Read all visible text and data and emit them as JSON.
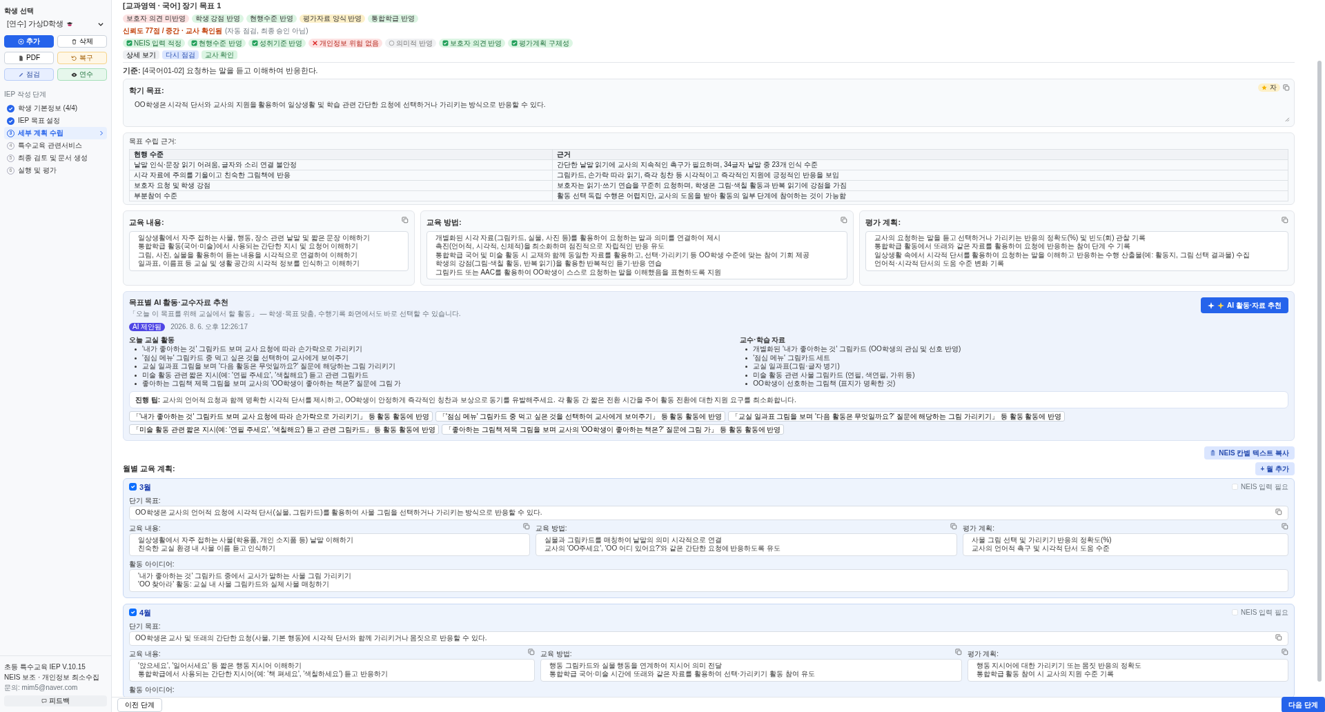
{
  "sidebar": {
    "student_label": "학생 선택",
    "student_select": "[연수] 가상D학생",
    "buttons": [
      {
        "label": "추가",
        "kind": "primary"
      },
      {
        "label": "삭제",
        "kind": "outline"
      },
      {
        "label": "PDF",
        "kind": "outline"
      },
      {
        "label": "복구",
        "kind": "warning"
      },
      {
        "label": "점검",
        "kind": "info"
      },
      {
        "label": "연수",
        "kind": "success"
      }
    ],
    "steps_title": "IEP 작성 단계",
    "steps": [
      {
        "label": "학생 기본정보 (4/4)",
        "done": true,
        "selected": false
      },
      {
        "label": "IEP 목표 설정",
        "done": true,
        "selected": false
      },
      {
        "number": "3",
        "label": "세부 계획 수립",
        "done": false,
        "selected": true
      },
      {
        "number": "4",
        "label": "특수교육 관련서비스",
        "done": false,
        "selected": false
      },
      {
        "number": "5",
        "label": "최종 검토 및 문서 생성",
        "done": false,
        "selected": false
      },
      {
        "number": "6",
        "label": "실행 및 평가",
        "done": false,
        "selected": false
      }
    ],
    "footer": {
      "version": "초등 특수교육 IEP V.10.15",
      "note": "NEIS 보조 · 개인정보 최소수집",
      "contact": "문의: mim5@naver.com",
      "feedback_button": "피드백"
    }
  },
  "goal": {
    "title": "[교과영역 · 국어] 장기 목표 1",
    "tags": [
      {
        "label": "보호자 의견 미반영",
        "color": "#fde2e2"
      },
      {
        "label": "학생 강점 반영",
        "color": "#dcf5e3"
      },
      {
        "label": "현행수준 반영",
        "color": "#dcf5e3"
      },
      {
        "label": "평가자료 양식 반영",
        "color": "#fdf0c8"
      },
      {
        "label": "통합학급 반영",
        "color": "#dcf5e3"
      }
    ],
    "reliability": "신뢰도 77점 / 중간 · 교사 확인됨",
    "reliability_note": "(자동 점검, 최종 승인 아님)",
    "checks": [
      {
        "label": "NEIS 입력 적정",
        "kind": "pass"
      },
      {
        "label": "현행수준 반영",
        "kind": "pass"
      },
      {
        "label": "성취기준 반영",
        "kind": "pass"
      },
      {
        "label": "개인정보 위험 없음",
        "kind": "fail"
      },
      {
        "label": "의미적 반영",
        "kind": "neutral"
      },
      {
        "label": "보호자 의견 반영",
        "kind": "pass"
      },
      {
        "label": "평가계획 구체성",
        "kind": "pass"
      }
    ],
    "actions": [
      {
        "label": "상세 보기",
        "kind": "gray"
      },
      {
        "label": "다시 점검",
        "kind": "blue"
      },
      {
        "label": "교사 확인",
        "kind": "green"
      }
    ],
    "standard": "**기준:** [4국어01-02] 요청하는 말을 듣고 이해하여 반응한다.",
    "semester_goal": {
      "title": "학기 목표:",
      "badge": "자",
      "text": "OO학생은 시각적 단서와 교사의 지원을 활용하여 일상생활 및 학습 관련 간단한 요청에 선택하거나 가리키는 방식으로 반응할 수 있다."
    }
  },
  "basis": {
    "title": "목표 수립 근거:",
    "columns": [
      "현행 수준",
      "근거"
    ],
    "rows": [
      [
        "낱말 인식·문장 읽기 어려움, 글자와 소리 연결 불안정",
        "간단한 낱말 읽기에 교사의 지속적인 촉구가 필요하며, 34글자 낱말 중 23개 인식 수준"
      ],
      [
        "시각 자료에 주의를 기울이고 친숙한 그림책에 반응",
        "그림카드, 손가락 따라 읽기, 즉각 칭찬 등 시각적이고 즉각적인 지원에 긍정적인 반응을 보임"
      ],
      [
        "보호자 요청 및 학생 강점",
        "보호자는 읽기·쓰기 연습을 꾸준히 요청하며, 학생은 그림·색칠 활동과 반복 읽기에 강점을 가짐"
      ],
      [
        "부분참여 수준",
        "활동 선택 독립 수행은 어렵지만, 교사의 도움을 받아 활동의 일부 단계에 참여하는 것이 가능함"
      ]
    ]
  },
  "plan_cards": [
    {
      "title": "교육 내용:",
      "lines": [
        "일상생활에서 자주 접하는 사물, 행동, 장소 관련 낱말 및 짧은 문장 이해하기",
        "통합학급 활동(국어·미술)에서 사용되는 간단한 지시 및 요청어 이해하기",
        "그림, 사진, 실물을 활용하여 듣는 내용을 시각적으로 연결하여 이해하기",
        "일과표, 이름표 등 교실 및 생활 공간의 시각적 정보를 인식하고 이해하기"
      ]
    },
    {
      "title": "교육 방법:",
      "lines": [
        "개별화된 시각 자료(그림카드, 실물, 사진 등)를 활용하여 요청하는 말과 의미를 연결하여 제시",
        "촉진(언어적, 시각적, 신체적)을 최소화하며 점진적으로 자립적인 반응 유도",
        "통합학급 국어 및 미술 활동 시 교재와 함께 동일한 자료를 활용하고, 선택·가리키기 등 OO학생 수준에 맞는 참여 기회 제공",
        "학생의 강점(그림·색칠 활동, 반복 읽기)을 활용한 반복적인 듣기·반응 연습",
        "그림카드 또는 AAC를 활용하여 OO학생이 스스로 요청하는 말을 이해했음을 표현하도록 지원"
      ]
    },
    {
      "title": "평가 계획:",
      "lines": [
        "교사의 요청하는 말을 듣고 선택하거나 가리키는 반응의 정확도(%) 및 빈도(회) 관찰 기록",
        "통합학급 활동에서 또래와 같은 자료를 활용하여 요청에 반응하는 참여 단계 수 기록",
        "일상생활 속에서 시각적 단서를 활용하여 요청하는 말을 이해하고 반응하는 수행 산출물(예: 활동지, 그림 선택 결과물) 수집",
        "언어적·시각적 단서의 도움 수준 변화 기록"
      ]
    }
  ],
  "ai": {
    "title": "목표별 AI 활동·교수자료 추천",
    "subtitle": "「오늘 이 목표를 위해 교실에서 할 활동」 — 학생·목표 맞춤, 수행기록 화면에서도 바로 선택할 수 있습니다.",
    "button": "AI 활동·자료 추천",
    "badge": "AI 제안됨",
    "date": "2026. 8. 6. 오후 12:26:17",
    "columns": [
      {
        "title": "오늘 교실 활동",
        "items": [
          "'내가 좋아하는 것' 그림카드 보며 교사 요청에 따라 손가락으로 가리키기",
          "'점심 메뉴' 그림카드 중 먹고 싶은 것을 선택하여 교사에게 보여주기",
          "교실 일과표 그림을 보며 '다음 활동은 무엇일까요?' 질문에 해당하는 그림 가리키기",
          "미술 활동 관련 짧은 지시(예: '연필 주세요', '색칠해요') 듣고 관련 그림카드",
          "좋아하는 그림책 제목 그림을 보며 교사의 'OO학생이 좋아하는 책은?' 질문에 그림 가"
        ]
      },
      {
        "title": "교수·학습 자료",
        "items": [
          "개별화된 '내가 좋아하는 것' 그림카드 (OO학생의 관심 및 선호 반영)",
          "'점심 메뉴' 그림카드 세트",
          "교실 일과표(그림·글자 병기)",
          "미술 활동 관련 사물 그림카드 (연필, 색연필, 가위 등)",
          "OO학생이 선호하는 그림책 (표지가 명확한 것)"
        ]
      }
    ],
    "tip": "**진행 팁:** 교사의 언어적 요청과 함께 명확한 시각적 단서를 제시하고, OO학생이 안정하게 즉각적인 칭찬과 보상으로 동기를 유발해주세요. 각 활동 간 짧은 전환 시간을 주어 활동 전환에 대한 지원 요구를 최소화합니다.",
    "chips": [
      "「'내가 좋아하는 것' 그림카드 보며 교사 요청에 따라 손가락으로 가리키기」 등 활동 활동에 반영",
      "「'점심 메뉴' 그림카드 중 먹고 싶은 것을 선택하여 교사에게 보여주기」 등 활동 활동에 반영",
      "「교실 일과표 그림을 보며 '다음 활동은 무엇일까요?' 질문에 해당하는 그림 가리키기」 등 활동 활동에 반영",
      "「미술 활동 관련 짧은 지시(예: '연필 주세요', '색칠해요') 듣고 관련 그림카드」 등 활동 활동에 반영",
      "「좋아하는 그림책 제목 그림을 보며 교사의 'OO학생이 좋아하는 책은?' 질문에 그림 가」 등 활동 활동에 반영"
    ]
  },
  "neis_copy_button": "NEIS 칸별 텍스트 복사",
  "monthly": {
    "title": "월별 교육 계획:",
    "add_button": "+ 월 추가",
    "months": [
      {
        "label": "3월",
        "checked": true,
        "neis_label": "NEIS 입력 필요",
        "neis_checked": false,
        "short_goal_label": "단기 목표:",
        "short_goal": "OO학생은 교사의 언어적 요청에 시각적 단서(실물, 그림카드)를 활용하여 사물 그림을 선택하거나 가리키는 방식으로 반응할 수 있다.",
        "sections": [
          {
            "title": "교육 내용:",
            "lines": [
              "일상생활에서 자주 접하는 사물(학용품, 개인 소지품 등) 낱말 이해하기",
              "친숙한 교실 환경 내 사물 이름 듣고 인식하기"
            ]
          },
          {
            "title": "교육 방법:",
            "lines": [
              "실물과 그림카드를 매칭하여 낱말의 의미 시각적으로 연결",
              "교사의 'OO주세요', 'OO 어디 있어요?'와 같은 간단한 요청에 반응하도록 유도"
            ]
          },
          {
            "title": "평가 계획:",
            "lines": [
              "사물 그림 선택 및 가리키기 반응의 정확도(%)",
              "교사의 언어적 촉구 및 시각적 단서 도움 수준"
            ]
          }
        ],
        "idea_label": "활동 아이디어:",
        "ideas": [
          "'내가 좋아하는 것' 그림카드 중에서 교사가 말하는 사물 그림 가리키기",
          "'OO 찾아라' 활동: 교실 내 사물 그림카드와 실제 사물 매칭하기"
        ]
      },
      {
        "label": "4월",
        "checked": true,
        "neis_label": "NEIS 입력 필요",
        "neis_checked": false,
        "short_goal_label": "단기 목표:",
        "short_goal": "OO학생은 교사 및 또래의 간단한 요청(사물, 기본 행동)에 시각적 단서와 함께 가리키거나 몸짓으로 반응할 수 있다.",
        "sections": [
          {
            "title": "교육 내용:",
            "lines": [
              "'앉으세요', '일어서세요' 등 짧은 행동 지시어 이해하기",
              "통합학급에서 사용되는 간단한 지시어(예: '책 펴세요', '색칠하세요') 듣고 반응하기"
            ]
          },
          {
            "title": "교육 방법:",
            "lines": [
              "행동 그림카드와 실물 행동을 연계하여 지시어 의미 전달",
              "통합학급 국어·미술 시간에 또래와 같은 자료를 활용하여 선택·가리키기 활동 참여 유도"
            ]
          },
          {
            "title": "평가 계획:",
            "lines": [
              "행동 지시어에 대한 가리키기 또는 몸짓 반응의 정확도",
              "통합학급 활동 참여 시 교사의 지원 수준 기록"
            ]
          }
        ],
        "idea_label": "활동 아이디어:"
      }
    ]
  },
  "footer_nav": {
    "prev": "이전 단계",
    "next": "다음 단계"
  }
}
